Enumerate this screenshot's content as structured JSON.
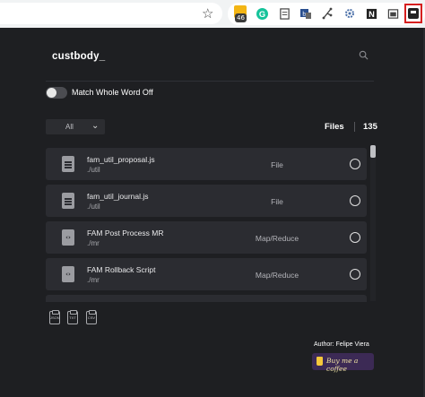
{
  "browser": {
    "ext_badge": "46"
  },
  "search": {
    "value": "custbody_"
  },
  "toggle": {
    "label": "Match Whole Word Off",
    "on": false
  },
  "filter": {
    "selected": "All"
  },
  "files": {
    "label": "Files",
    "count": "135"
  },
  "rows": [
    {
      "name": "fam_util_proposal.js",
      "path": "./util",
      "type": "File",
      "icon": "document-icon"
    },
    {
      "name": "fam_util_journal.js",
      "path": "./util",
      "type": "File",
      "icon": "document-icon"
    },
    {
      "name": "FAM Post Process MR",
      "path": "./mr",
      "type": "Map/Reduce",
      "icon": "script-icon"
    },
    {
      "name": "FAM Rollback Script",
      "path": "./mr",
      "type": "Map/Reduce",
      "icon": "script-icon"
    }
  ],
  "export": {
    "json": "JSON",
    "txt": "TXT",
    "csv": "CSV"
  },
  "footer": {
    "author": "Author: Felipe Viera",
    "coffee": "Buy me a coffee"
  },
  "colors": {
    "popup_bg": "#1e1f22",
    "row_bg": "#2b2c31",
    "highlight": "#d61f1f"
  }
}
